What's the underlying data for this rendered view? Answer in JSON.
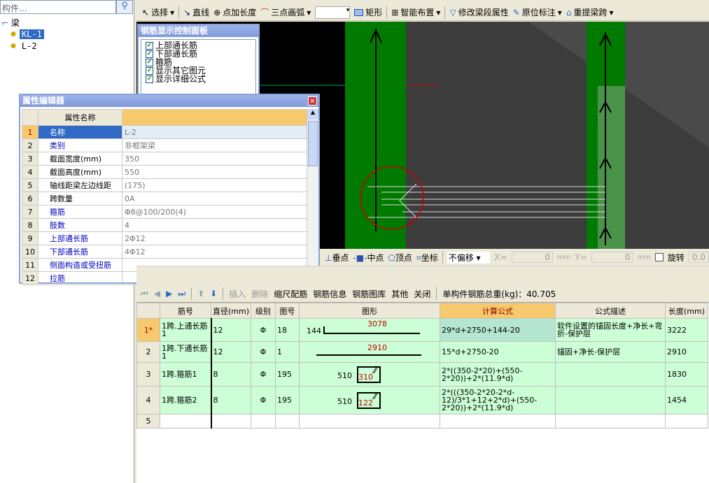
{
  "tree": {
    "search_placeholder": "构件...",
    "root": "梁",
    "items": [
      "KL-1",
      "L-2"
    ]
  },
  "toolbar": {
    "select": "选择",
    "line": "直线",
    "point_length": "点加长度",
    "arc": "三点画弧",
    "rect": "矩形",
    "smart": "智能布置",
    "modify": "修改梁段属性",
    "inplace": "原位标注",
    "respan": "重提梁跨"
  },
  "control_panel": {
    "title": "钢筋显示控制面板",
    "items": [
      "上部通长筋",
      "下部通长筋",
      "箍筋",
      "显示其它图元",
      "显示详细公式"
    ]
  },
  "property_editor": {
    "title": "属性编辑器",
    "header": "属性名称",
    "rows": [
      {
        "n": "1",
        "name": "名称",
        "value": "L-2",
        "blue": false
      },
      {
        "n": "2",
        "name": "类别",
        "value": "非框架梁",
        "blue": true
      },
      {
        "n": "3",
        "name": "截面宽度(mm)",
        "value": "350",
        "blue": false
      },
      {
        "n": "4",
        "name": "截面高度(mm)",
        "value": "550",
        "blue": false
      },
      {
        "n": "5",
        "name": "轴线距梁左边线距",
        "value": "(175)",
        "blue": false
      },
      {
        "n": "6",
        "name": "跨数量",
        "value": "0A",
        "blue": false
      },
      {
        "n": "7",
        "name": "箍筋",
        "value": "Φ8@100/200(4)",
        "blue": true
      },
      {
        "n": "8",
        "name": "肢数",
        "value": "4",
        "blue": true
      },
      {
        "n": "9",
        "name": "上部通长筋",
        "value": "2Φ12",
        "blue": true
      },
      {
        "n": "10",
        "name": "下部通长筋",
        "value": "4Φ12",
        "blue": true
      },
      {
        "n": "11",
        "name": "侧面构造或受扭筋",
        "value": "",
        "blue": true
      },
      {
        "n": "12",
        "name": "拉筋",
        "value": "",
        "blue": true
      }
    ]
  },
  "snap": {
    "perp": "垂点",
    "mid": "中点",
    "vertex": "顶点",
    "coord": "坐标",
    "offset": "不偏移",
    "x_label": "X=",
    "x": "0",
    "y_label": "Y=",
    "y": "0",
    "unit": "mm",
    "rotate": "旋转",
    "rotate_val": "0.0"
  },
  "rebar_bar": {
    "insert": "插入",
    "delete": "删除",
    "scale": "缩尺配筋",
    "info": "钢筋信息",
    "library": "钢筋图库",
    "other": "其他",
    "close": "关闭",
    "total": "单构件钢筋总重(kg)：40.705"
  },
  "grid": {
    "headers": [
      "",
      "筋号",
      "直径(mm)",
      "级别",
      "图号",
      "图形",
      "计算公式",
      "公式描述",
      "长度(mm)"
    ],
    "rows": [
      {
        "n": "1*",
        "name": "1跨.上通长筋1",
        "dia": "12",
        "grade": "Φ",
        "fig": "18",
        "shape_left": "144",
        "shape_val": "3078",
        "formula": "29*d+2750+144-20",
        "desc": "软件设置的锚固长度+净长+弯折-保护层",
        "len": "3222"
      },
      {
        "n": "2",
        "name": "1跨.下通长筋1",
        "dia": "12",
        "grade": "Φ",
        "fig": "1",
        "shape_left": "",
        "shape_val": "2910",
        "formula": "15*d+2750-20",
        "desc": "锚固+净长-保护层",
        "len": "2910"
      },
      {
        "n": "3",
        "name": "1跨.箍筋1",
        "dia": "8",
        "grade": "Φ",
        "fig": "195",
        "shape_left": "510",
        "shape_val": "310",
        "formula": "2*((350-2*20)+(550-2*20))+2*(11.9*d)",
        "desc": "",
        "len": "1830"
      },
      {
        "n": "4",
        "name": "1跨.箍筋2",
        "dia": "8",
        "grade": "Φ",
        "fig": "195",
        "shape_left": "510",
        "shape_val": "122",
        "formula": "2*(((350-2*20-2*d-12)/3*1+12+2*d)+(550-2*20))+2*(11.9*d)",
        "desc": "",
        "len": "1454"
      },
      {
        "n": "5",
        "name": "",
        "dia": "",
        "grade": "",
        "fig": "",
        "shape_left": "",
        "shape_val": "",
        "formula": "",
        "desc": "",
        "len": ""
      }
    ]
  },
  "colors": {
    "canvas": "#000000",
    "beam_green": "#007a00",
    "grid_row": "#ccffd6",
    "active_header": "#f8c96c"
  }
}
